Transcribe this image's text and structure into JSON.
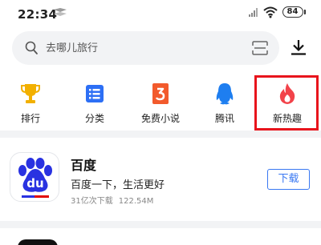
{
  "status_bar": {
    "time": "22:34",
    "battery": "84",
    "icons": [
      "notification-icon",
      "signal-icon",
      "wifi-icon",
      "battery-icon"
    ]
  },
  "search": {
    "placeholder": "去哪儿旅行",
    "icons": [
      "search-icon",
      "scan-icon",
      "download-icon"
    ]
  },
  "categories": [
    {
      "label": "排行",
      "icon": "trophy-icon"
    },
    {
      "label": "分类",
      "icon": "list-icon"
    },
    {
      "label": "免费小说",
      "icon": "book-icon"
    },
    {
      "label": "腾讯",
      "icon": "penguin-icon"
    },
    {
      "label": "新热趣",
      "icon": "flame-icon"
    }
  ],
  "highlight_color": "#e8141c",
  "app": {
    "name": "百度",
    "description": "百度一下，生活更好",
    "downloads": "31亿次下载",
    "size": "122.54M",
    "download_label": "下载",
    "icon_text": "du"
  },
  "colors": {
    "accent": "#3978f2",
    "baidu_blue": "#2932e1",
    "baidu_red": "#e10602"
  }
}
